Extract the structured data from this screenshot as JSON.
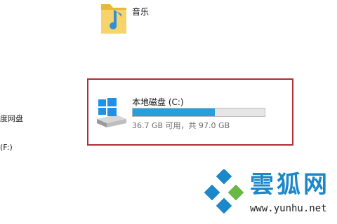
{
  "folders": {
    "music": {
      "label": "音乐",
      "icon": "music-folder-icon"
    }
  },
  "nav": {
    "cloud_label": "度网盘",
    "drive_f_label": "(F:)"
  },
  "drive_c": {
    "name": "本地磁盘 (C:)",
    "space_text": "36.7 GB 可用，共 97.0 GB",
    "free_gb": 36.7,
    "total_gb": 97.0,
    "used_fraction": 0.62,
    "icon": "windows-drive-icon",
    "bar_color": "#26a0da",
    "highlight_color": "#b32b35"
  },
  "watermark": {
    "text": "雲狐网",
    "url": "www.yunhu.net",
    "color": "#1c87c9",
    "icon": "yunhu-logo-icon"
  }
}
